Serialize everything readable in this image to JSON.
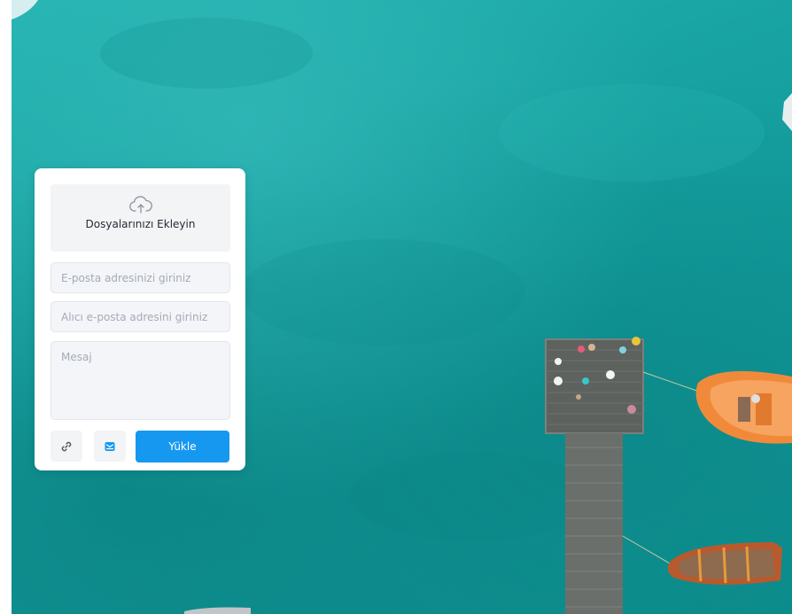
{
  "upload_form": {
    "dropzone_label": "Dosyalarınızı Ekleyin",
    "email_placeholder": "E-posta adresinizi giriniz",
    "recipient_placeholder": "Alıcı e-posta adresini giriniz",
    "message_placeholder": "Mesaj",
    "link_icon": "link-icon",
    "mail_icon": "mail-icon",
    "upload_icon": "cloud-upload-icon",
    "upload_label": "Yükle"
  },
  "colors": {
    "primary": "#1698f0",
    "water": "#18a3a2",
    "boat": "#f08a3a"
  }
}
